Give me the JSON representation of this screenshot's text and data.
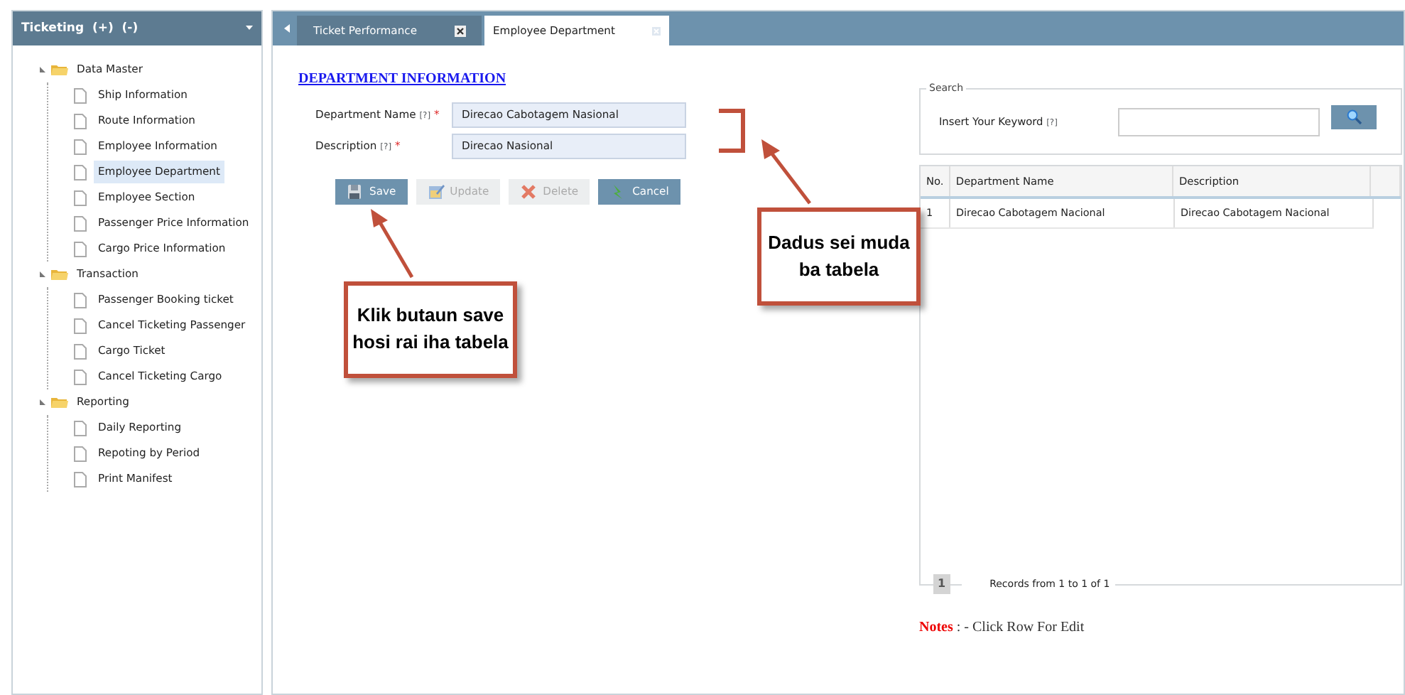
{
  "sidebar": {
    "title": "Ticketing  (+)  (-)",
    "tree": [
      {
        "label": "Data Master",
        "expanded": true,
        "children": [
          {
            "label": "Ship Information",
            "selected": false
          },
          {
            "label": "Route Information",
            "selected": false
          },
          {
            "label": "Employee Information",
            "selected": false
          },
          {
            "label": "Employee Department",
            "selected": true
          },
          {
            "label": "Employee Section",
            "selected": false
          },
          {
            "label": "Passenger Price Information",
            "selected": false
          },
          {
            "label": "Cargo Price Information",
            "selected": false
          }
        ]
      },
      {
        "label": "Transaction",
        "expanded": true,
        "children": [
          {
            "label": "Passenger Booking ticket",
            "selected": false
          },
          {
            "label": "Cancel Ticketing Passenger",
            "selected": false
          },
          {
            "label": "Cargo Ticket",
            "selected": false
          },
          {
            "label": "Cancel Ticketing Cargo",
            "selected": false
          }
        ]
      },
      {
        "label": "Reporting",
        "expanded": true,
        "children": [
          {
            "label": "Daily Reporting",
            "selected": false
          },
          {
            "label": "Repoting by Period",
            "selected": false
          },
          {
            "label": "Print Manifest",
            "selected": false
          }
        ]
      }
    ]
  },
  "tabs": [
    {
      "label": "Ticket Performance",
      "selected": false
    },
    {
      "label": "Employee Department",
      "selected": true
    }
  ],
  "form": {
    "heading": "DEPARTMENT INFORMATION",
    "fields": [
      {
        "label": "Department Name",
        "hint": "[?]",
        "required_mark": "*",
        "value": "Direcao Cabotagem Nasional"
      },
      {
        "label": "Description",
        "hint": "[?]",
        "required_mark": "*",
        "value": "Direcao Nasional"
      }
    ],
    "buttons": [
      {
        "kind": "save",
        "label": "Save",
        "disabled": false
      },
      {
        "kind": "update",
        "label": "Update",
        "disabled": true
      },
      {
        "kind": "delete",
        "label": "Delete",
        "disabled": true
      },
      {
        "kind": "cancel",
        "label": "Cancel",
        "disabled": false
      }
    ]
  },
  "search": {
    "legend": "Search",
    "label": "Insert Your Keyword",
    "hint": "[?]"
  },
  "table": {
    "columns": [
      "No.",
      "Department Name",
      "Description"
    ],
    "rows": [
      [
        "1",
        "Direcao Cabotagem Nacional",
        "Direcao Cabotagem Nacional"
      ]
    ]
  },
  "pager": {
    "page": "1",
    "records": "Records from 1 to 1 of 1"
  },
  "notes": {
    "label": "Notes",
    "text": ": - Click Row For Edit"
  },
  "callouts": [
    {
      "lines": [
        "Klik butaun save",
        "hosi rai iha tabela"
      ]
    },
    {
      "lines": [
        "Dadus sei muda",
        "ba tabela"
      ]
    }
  ]
}
